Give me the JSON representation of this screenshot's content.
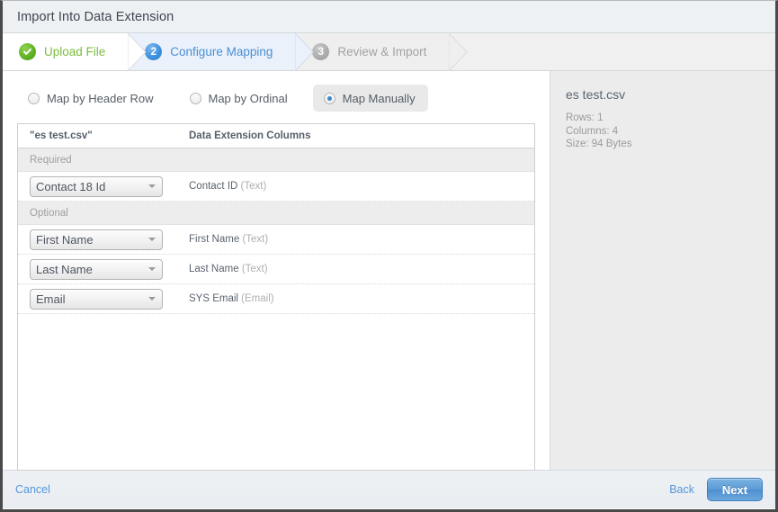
{
  "window": {
    "title": "Import Into Data Extension"
  },
  "steps": [
    {
      "badge": "check-icon",
      "label": "Upload File",
      "state": "done"
    },
    {
      "badge": "2",
      "label": "Configure Mapping",
      "state": "current"
    },
    {
      "badge": "3",
      "label": "Review & Import",
      "state": "todo"
    }
  ],
  "mapping_modes": [
    {
      "label": "Map by Header Row",
      "selected": false
    },
    {
      "label": "Map by Ordinal",
      "selected": false
    },
    {
      "label": "Map Manually",
      "selected": true
    }
  ],
  "table": {
    "headers": {
      "source": "\"es test.csv\"",
      "target": "Data Extension Columns"
    },
    "sections": [
      {
        "title": "Required",
        "rows": [
          {
            "source_value": "Contact 18 Id",
            "target_name": "Contact ID",
            "target_type": "(Text)"
          }
        ]
      },
      {
        "title": "Optional",
        "rows": [
          {
            "source_value": "First Name",
            "target_name": "First Name",
            "target_type": "(Text)"
          },
          {
            "source_value": "Last Name",
            "target_name": "Last Name",
            "target_type": "(Text)"
          },
          {
            "source_value": "Email",
            "target_name": "SYS Email",
            "target_type": "(Email)"
          }
        ]
      }
    ]
  },
  "file_info": {
    "name": "es test.csv",
    "rows": "Rows: 1",
    "columns": "Columns: 4",
    "size": "Size: 94 Bytes"
  },
  "footer": {
    "cancel": "Cancel",
    "back": "Back",
    "next": "Next"
  },
  "colors": {
    "accent_blue": "#5596da",
    "step_done_green": "#7bbd3c",
    "step_current_blue": "#4a8fd4",
    "step_todo_gray": "#a2a2a2",
    "panel_gray": "#ececec"
  }
}
